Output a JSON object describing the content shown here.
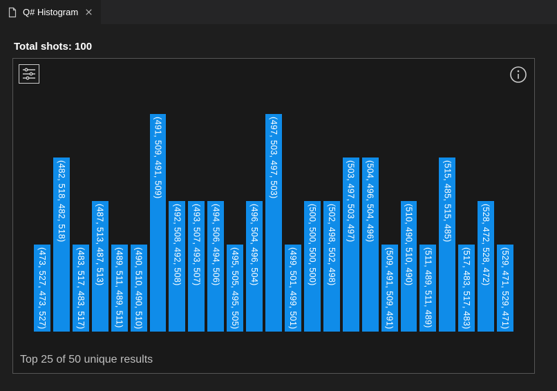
{
  "tab": {
    "title": "Q# Histogram"
  },
  "header": {
    "total_shots_label": "Total shots: 100"
  },
  "footer": {
    "caption": "Top 25 of 50 unique results"
  },
  "colors": {
    "bar": "#0f8ce9",
    "bg": "#1e1e1e"
  },
  "max_count": 5,
  "chart_data": {
    "type": "bar",
    "title": "Q# Histogram",
    "subtitle": "Top 25 of 50 unique results",
    "xlabel": "",
    "ylabel": "",
    "ylim": [
      0,
      5
    ],
    "categories": [
      "(473, 527, 473, 527)",
      "(482, 518, 482, 518)",
      "(483, 517, 483, 517)",
      "(487, 513, 487, 513)",
      "(489, 511, 489, 511)",
      "(490, 510, 490, 510)",
      "(491, 509, 491, 509)",
      "(492, 508, 492, 508)",
      "(493, 507, 493, 507)",
      "(494, 506, 494, 506)",
      "(495, 505, 495, 505)",
      "(496, 504, 496, 504)",
      "(497, 503, 497, 503)",
      "(499, 501, 499, 501)",
      "(500, 500, 500, 500)",
      "(502, 498, 502, 498)",
      "(503, 497, 503, 497)",
      "(504, 496, 504, 496)",
      "(509, 491, 509, 491)",
      "(510, 490, 510, 490)",
      "(511, 489, 511, 489)",
      "(515, 485, 515, 485)",
      "(517, 483, 517, 483)",
      "(528, 472, 528, 472)",
      "(529, 471, 529, 471)"
    ],
    "values": [
      2,
      4,
      2,
      3,
      2,
      2,
      5,
      3,
      3,
      3,
      2,
      3,
      5,
      2,
      3,
      3,
      4,
      4,
      2,
      3,
      2,
      4,
      2,
      3,
      2
    ]
  }
}
